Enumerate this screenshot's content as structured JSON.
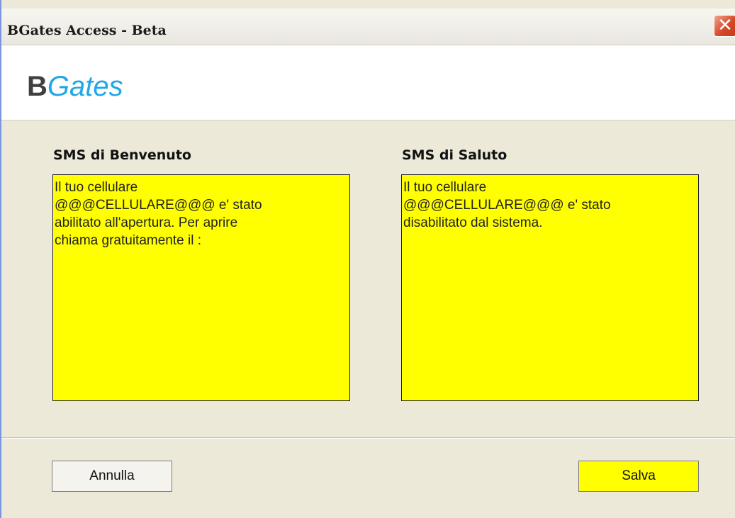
{
  "window": {
    "title": "BGates Access - Beta",
    "close_icon": "close-icon"
  },
  "logo": {
    "part1": "B",
    "part2": "Gates",
    "color_b": "#404040",
    "color_gates": "#1fa7e6"
  },
  "welcome_sms": {
    "label": "SMS di Benvenuto",
    "value": "Il tuo cellulare\n@@@CELLULARE@@@ e' stato\nabilitato all'apertura. Per aprire\nchiama gratuitamente il :"
  },
  "goodbye_sms": {
    "label": "SMS di Saluto",
    "value": "Il tuo cellulare\n@@@CELLULARE@@@ e' stato\ndisabilitato dal sistema."
  },
  "buttons": {
    "cancel_label": "Annulla",
    "save_label": "Salva"
  },
  "colors": {
    "textarea_background": "#ffff00",
    "save_button_background": "#ffff00",
    "window_background": "#ece9d8"
  }
}
